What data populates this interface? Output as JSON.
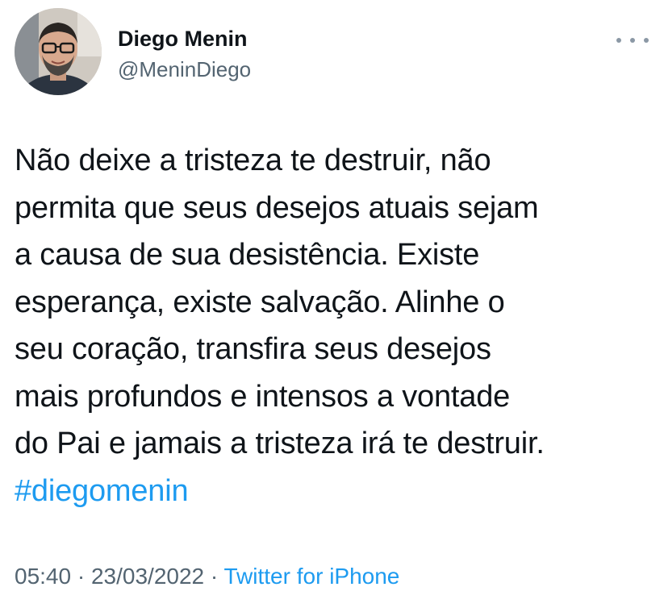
{
  "author": {
    "display_name": "Diego Menin",
    "handle": "@MeninDiego",
    "avatar_icon": "profile-photo"
  },
  "menu": {
    "icon": "more-options-icon"
  },
  "tweet": {
    "text": "Não deixe a tristeza te destruir, não\npermita que seus desejos atuais sejam\na causa de sua desistência. Existe\nesperança, existe salvação. Alinhe o\nseu coração, transfira seus desejos\nmais profundos e intensos a vontade\ndo Pai e jamais a tristeza irá te destruir.",
    "hashtag": "#diegomenin"
  },
  "meta": {
    "time": "05:40",
    "separator1": " · ",
    "date": "23/03/2022",
    "separator2": " · ",
    "source": "Twitter for iPhone"
  },
  "colors": {
    "link": "#1d9bf0",
    "secondary_text": "#536471",
    "primary_text": "#0f1419"
  }
}
